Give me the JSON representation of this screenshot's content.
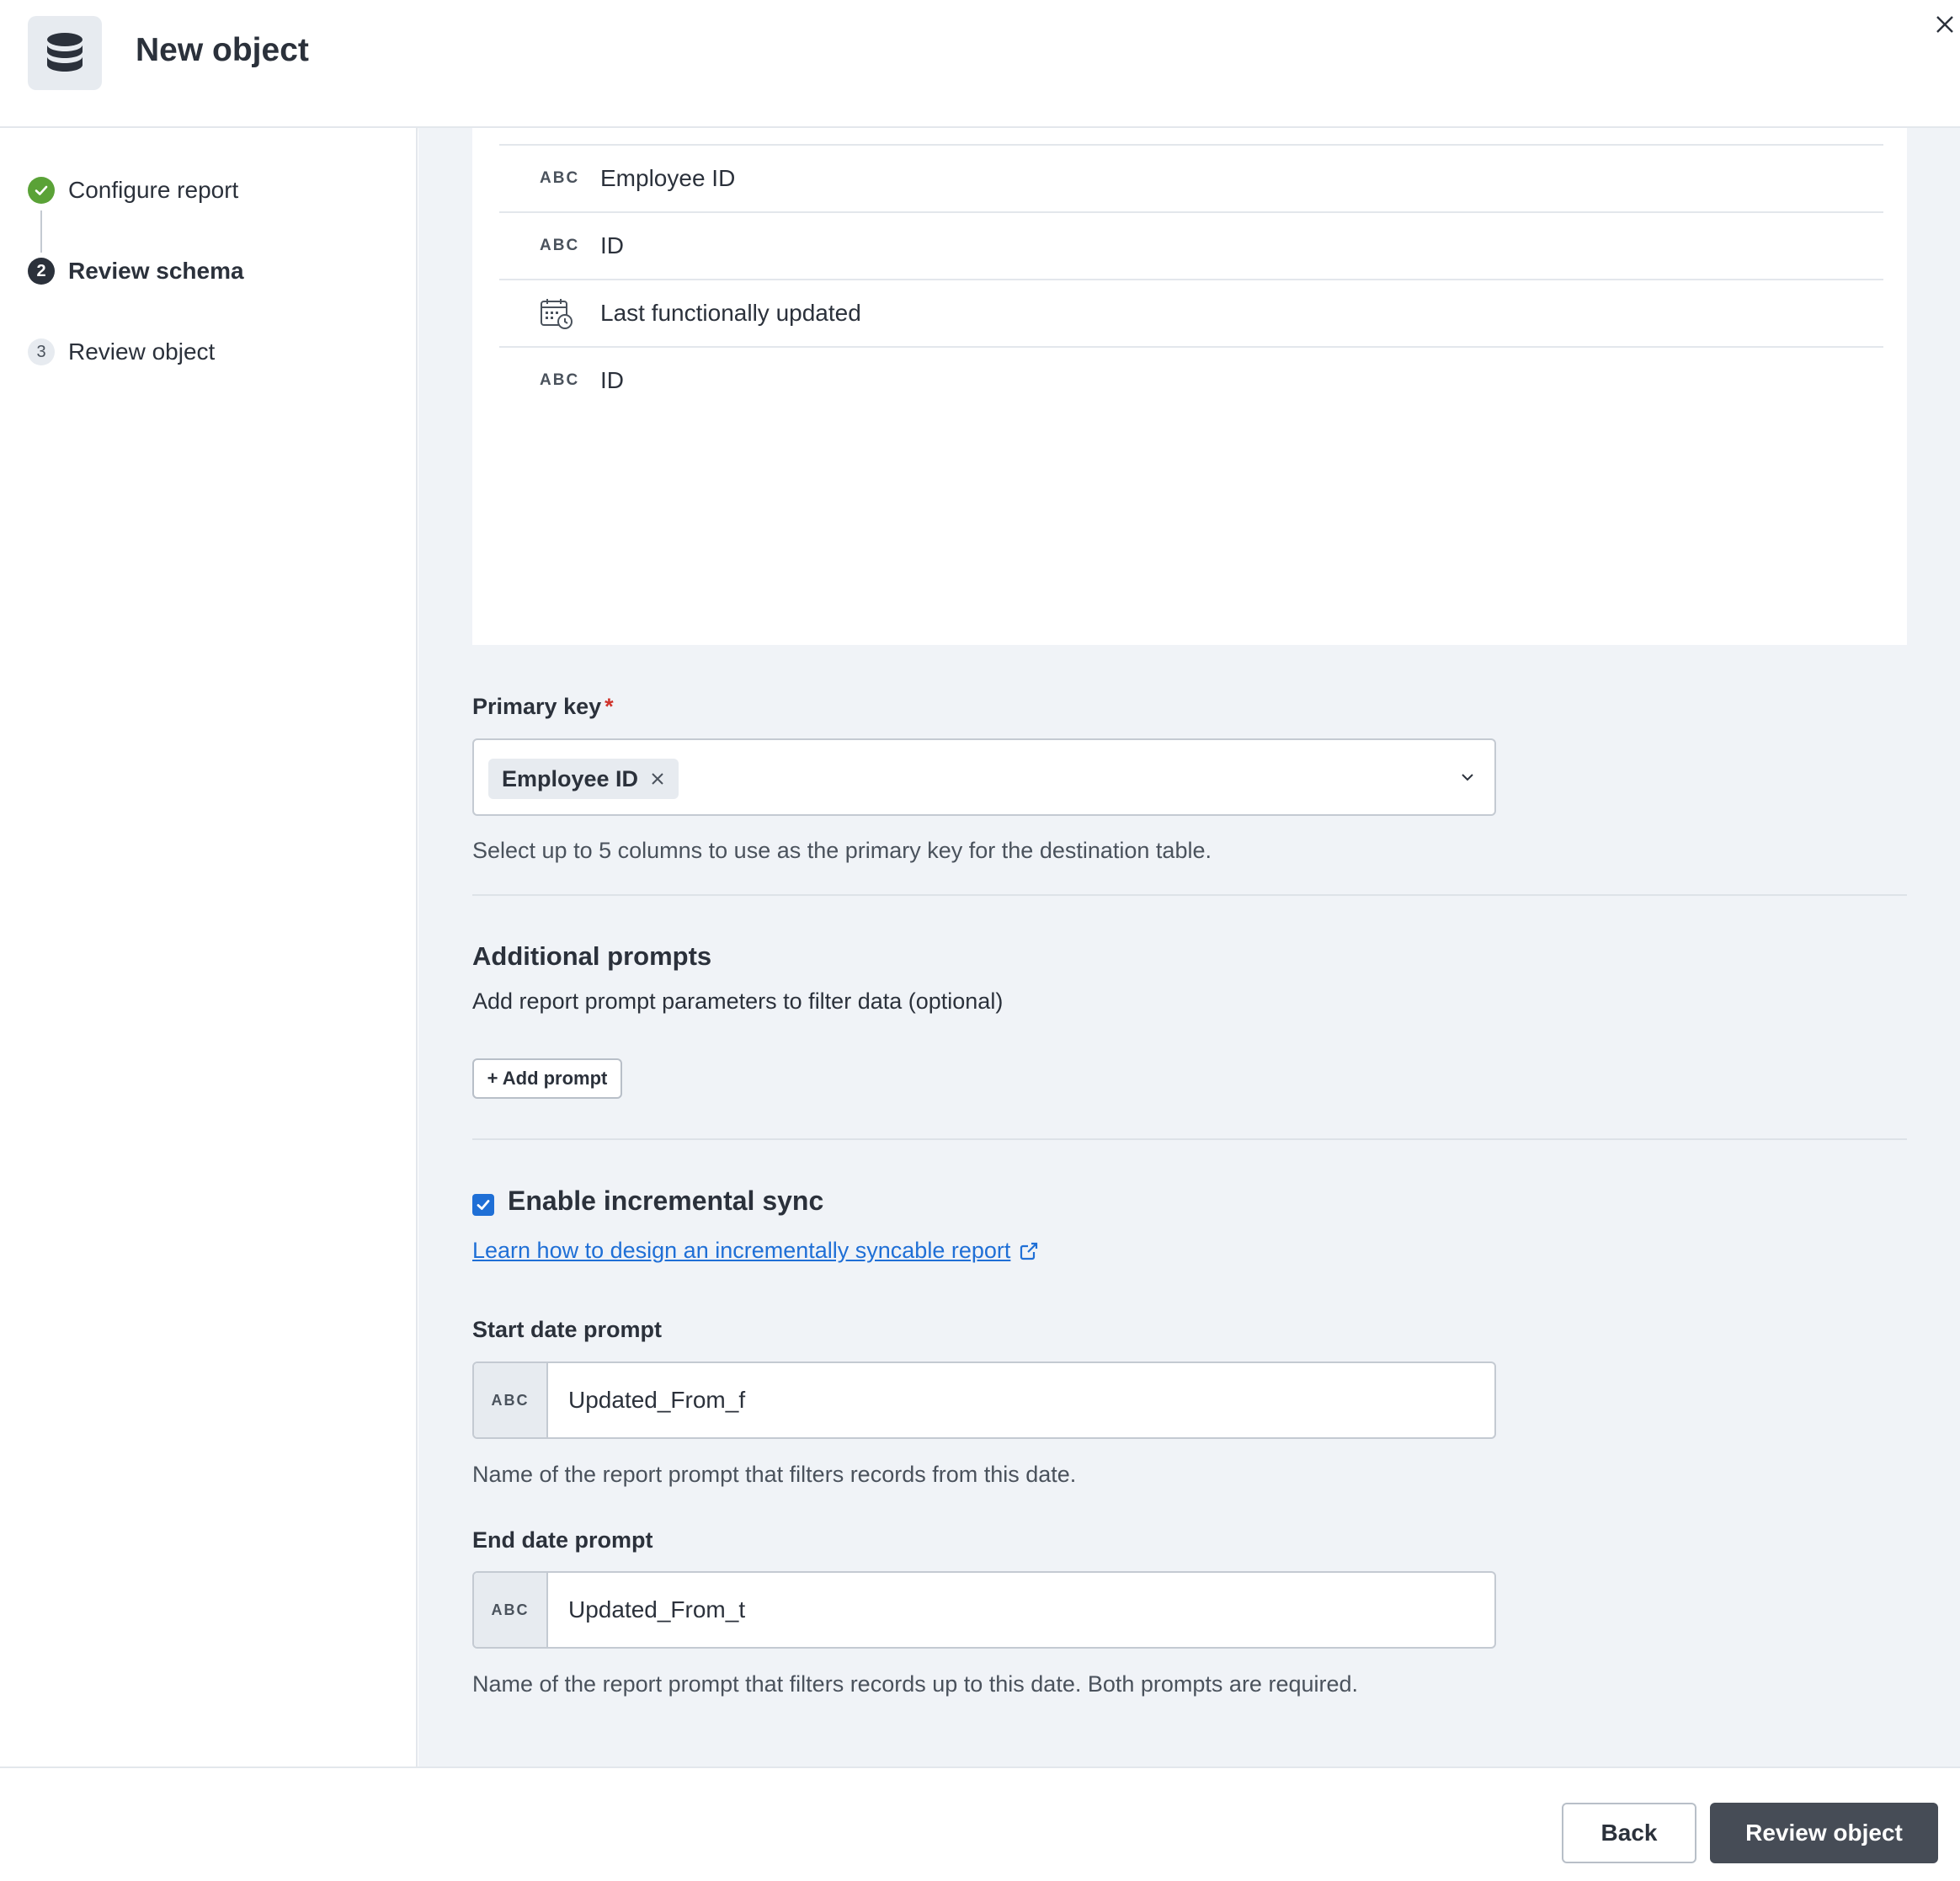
{
  "header": {
    "title": "New object",
    "icon": "database-icon"
  },
  "sidebar": {
    "steps": [
      {
        "number": "",
        "label": "Configure report",
        "state": "complete"
      },
      {
        "number": "2",
        "label": "Review schema",
        "state": "current"
      },
      {
        "number": "3",
        "label": "Review object",
        "state": "upcoming"
      }
    ]
  },
  "schema": {
    "columns": [
      {
        "type": "ABC",
        "name": "Employee ID"
      },
      {
        "type": "ABC",
        "name": "ID"
      },
      {
        "type": "date-icon",
        "name": "Last functionally updated"
      },
      {
        "type": "ABC",
        "name": "ID"
      }
    ]
  },
  "primary_key": {
    "label": "Primary key",
    "required_marker": "*",
    "selected": [
      "Employee ID"
    ],
    "help": "Select up to 5 columns to use as the primary key for the destination table."
  },
  "additional_prompts": {
    "title": "Additional prompts",
    "description": "Add report prompt parameters to filter data (optional)",
    "add_button": "+ Add prompt"
  },
  "incremental_sync": {
    "checked": true,
    "label": "Enable incremental sync",
    "link_text": "Learn how to design an incrementally syncable report",
    "start": {
      "label": "Start date prompt",
      "prefix": "ABC",
      "value": "Updated_From_f",
      "help": "Name of the report prompt that filters records from this date."
    },
    "end": {
      "label": "End date prompt",
      "prefix": "ABC",
      "value": "Updated_From_t",
      "help": "Name of the report prompt that filters records up to this date. Both prompts are required."
    }
  },
  "footer": {
    "back": "Back",
    "primary": "Review object"
  },
  "colors": {
    "primary_button": "#464c56",
    "link": "#1f6fd6",
    "checkbox": "#1f6fd6",
    "complete_step": "#5aa237",
    "required": "#d0342c"
  }
}
